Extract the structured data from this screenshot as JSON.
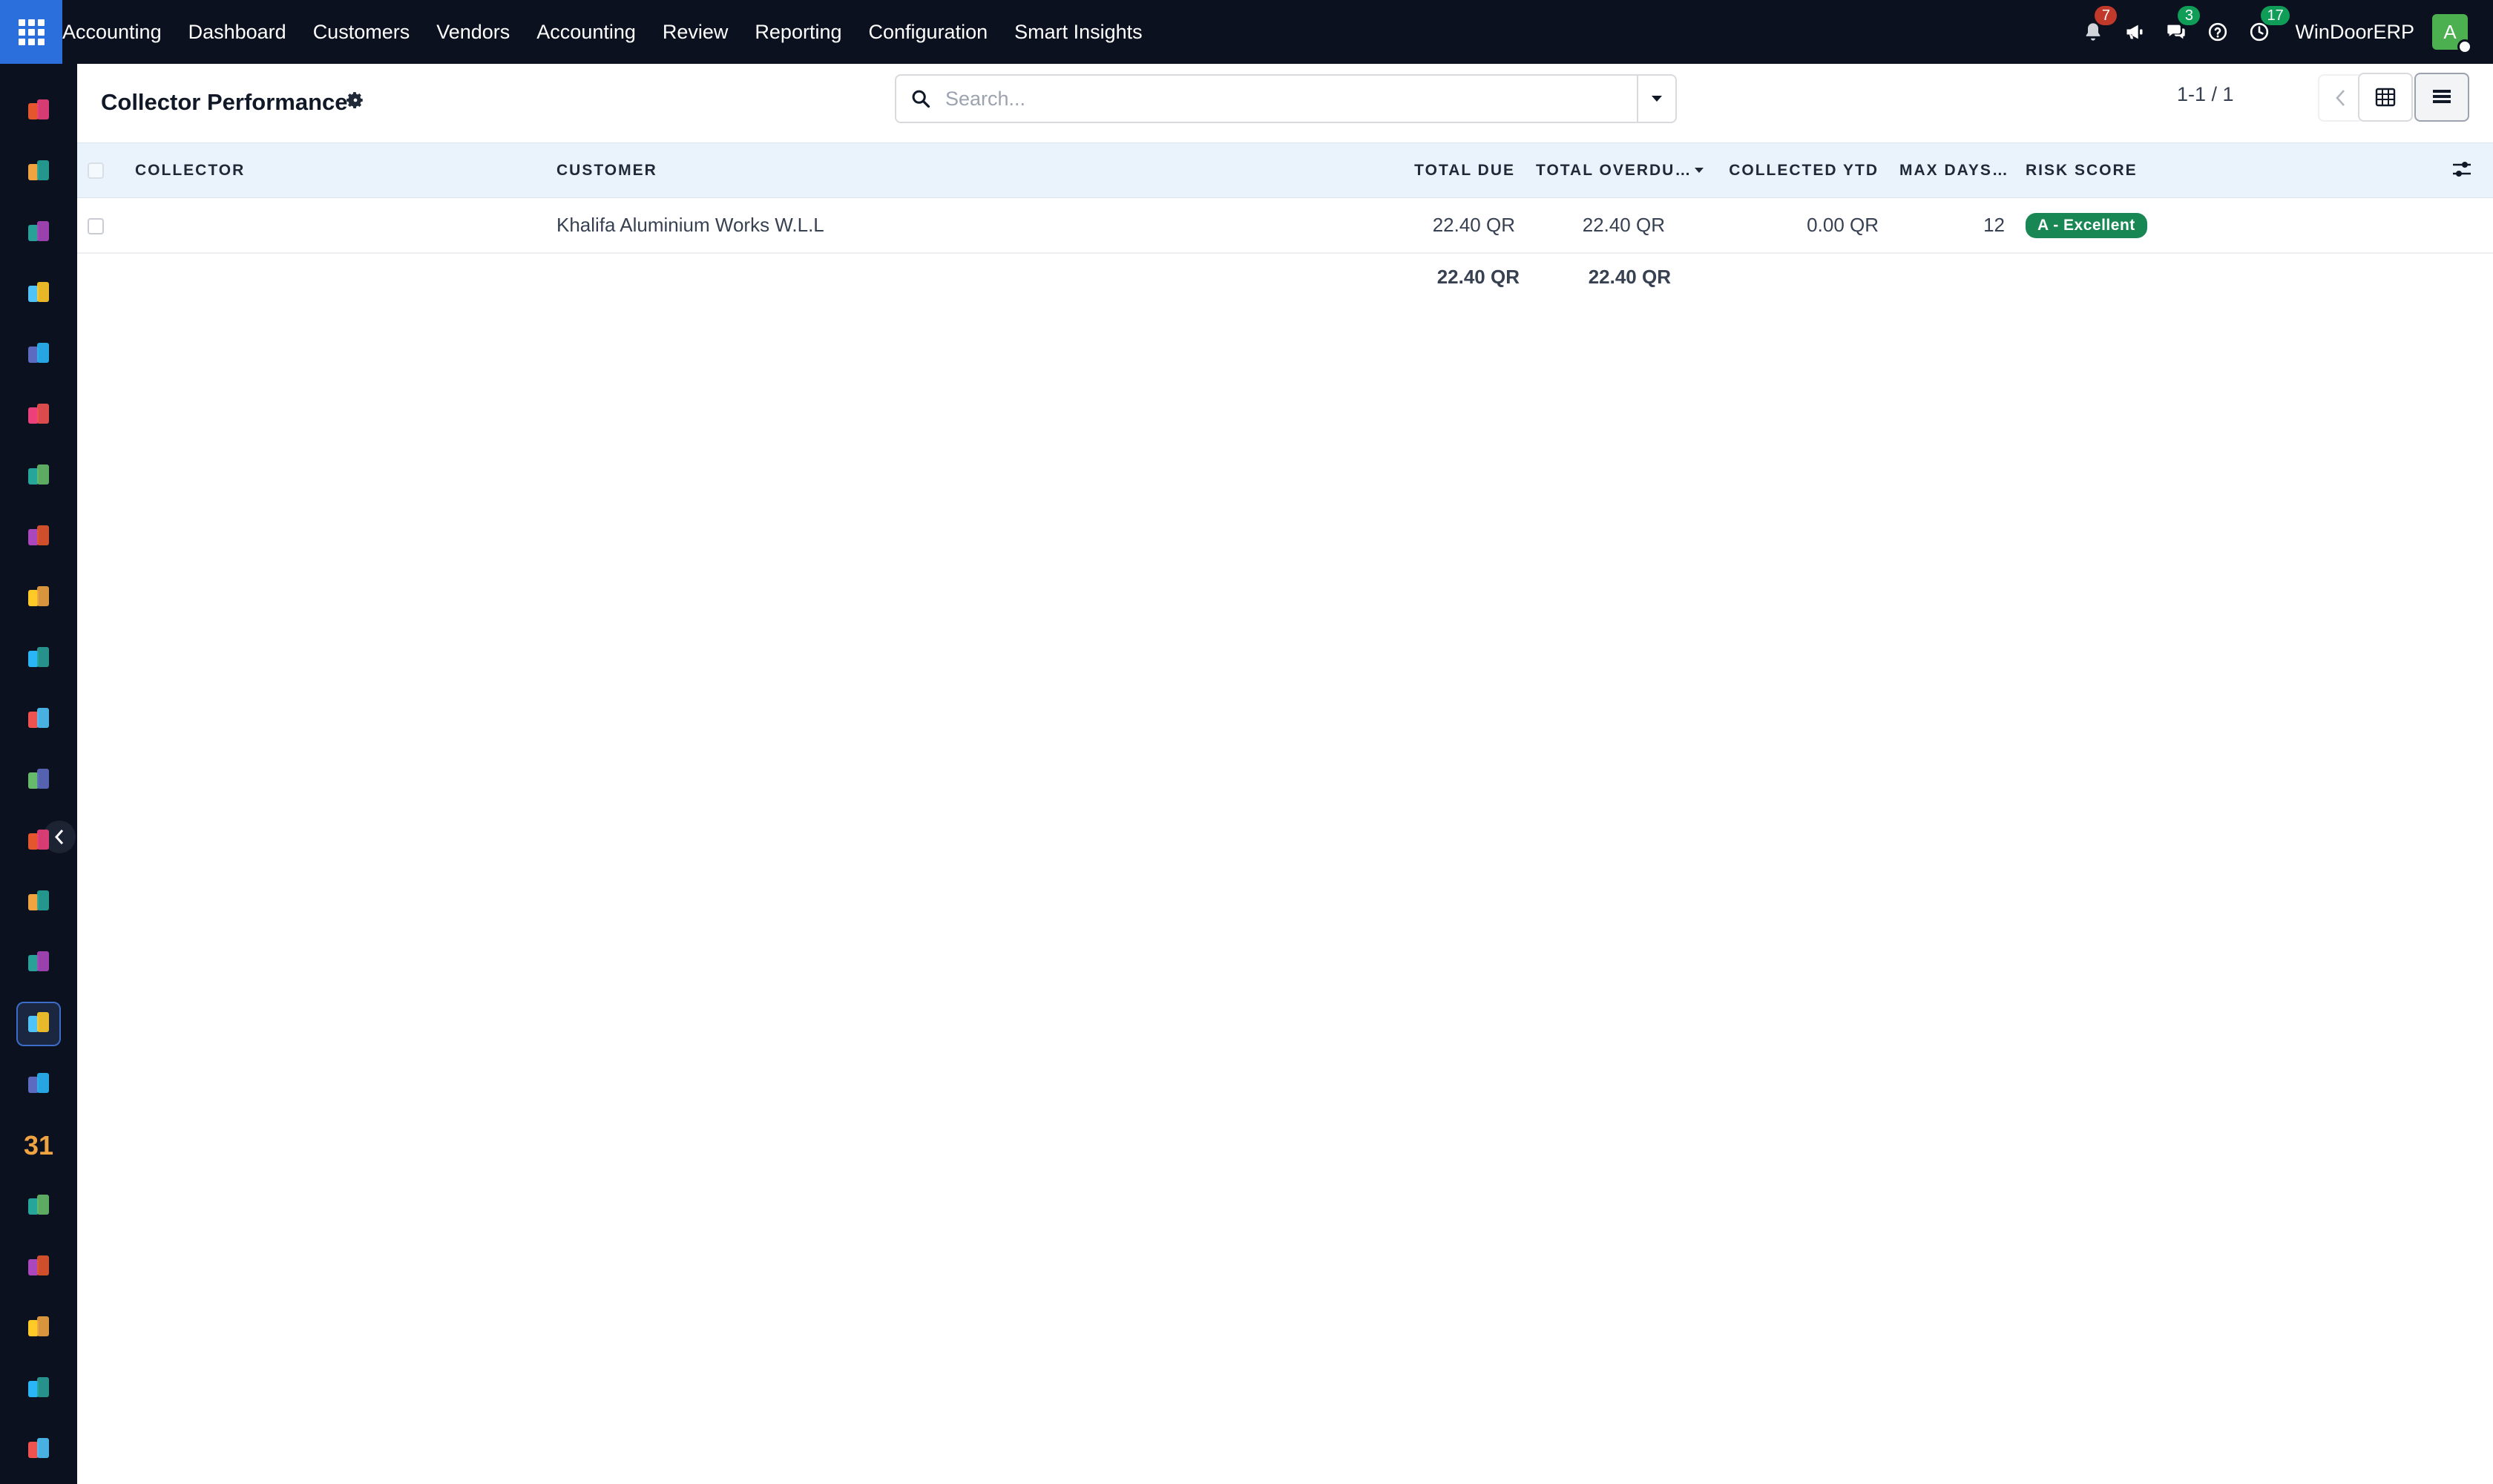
{
  "app": {
    "brand": "Accounting",
    "menu": [
      "Dashboard",
      "Customers",
      "Vendors",
      "Accounting",
      "Review",
      "Reporting",
      "Configuration",
      "Smart Insights"
    ],
    "company": "WinDoorERP",
    "avatar_letter": "A",
    "badges": {
      "notifications": "7",
      "messages": "3",
      "activities": "17"
    },
    "colors": {
      "navbar": "#0c1120",
      "accent": "#2a6fdb",
      "badge_red": "#c0392b",
      "badge_green": "#0f9d58",
      "risk_excellent": "#198754"
    }
  },
  "sidebar": {
    "apps": [
      "bar-chart-icon",
      "expenses-icon",
      "contacts-icon",
      "discuss-icon",
      "website-icon",
      "email-marketing-icon",
      "livechat-icon",
      "invoicing-icon",
      "reporting-icon",
      "employees-icon",
      "inventory-icon",
      "sales-icon",
      "project-icon",
      "knowledge-icon",
      "packages-icon",
      "accounting-icon",
      "team-icon",
      "calendar-icon",
      "sign-icon",
      "dashboards-icon",
      "whatsapp-icon",
      "timer-icon",
      "website-alt-icon"
    ],
    "active_index": 15,
    "calendar_label": "31"
  },
  "control": {
    "title": "Collector Performance",
    "search_placeholder": "Search...",
    "pager": "1-1 / 1"
  },
  "table": {
    "columns": {
      "collector": "Collector",
      "customer": "Customer",
      "total_due": "Total Due",
      "total_overdue": "Total Overdu…",
      "collected_ytd": "Collected YTD",
      "max_days": "Max Days…",
      "risk_score": "Risk Score"
    },
    "rows": [
      {
        "collector": "",
        "customer": "Khalifa Aluminium Works W.L.L",
        "total_due": "22.40 QR",
        "total_overdue": "22.40 QR",
        "collected_ytd": "0.00 QR",
        "max_days": "12",
        "risk_score": "A - Excellent"
      }
    ],
    "totals": {
      "total_due": "22.40 QR",
      "total_overdue": "22.40 QR"
    }
  }
}
